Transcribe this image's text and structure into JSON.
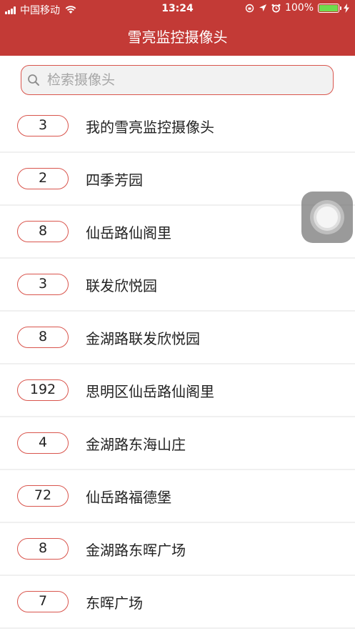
{
  "status_bar": {
    "carrier": "中国移动",
    "time": "13:24",
    "battery_percent": "100%",
    "icons": [
      "signal-icon",
      "wifi-icon",
      "rotation-lock-icon",
      "location-icon",
      "alarm-icon",
      "battery-icon",
      "charging-icon"
    ]
  },
  "header": {
    "title": "雪亮监控摄像头",
    "background": "#c33a36"
  },
  "search": {
    "placeholder": "检索摄像头",
    "value": ""
  },
  "accent": "#d9554d",
  "list": [
    {
      "count": "3",
      "name": "我的雪亮监控摄像头"
    },
    {
      "count": "2",
      "name": "四季芳园"
    },
    {
      "count": "8",
      "name": "仙岳路仙阁里"
    },
    {
      "count": "3",
      "name": "联发欣悦园"
    },
    {
      "count": "8",
      "name": "金湖路联发欣悦园"
    },
    {
      "count": "192",
      "name": "思明区仙岳路仙阁里"
    },
    {
      "count": "4",
      "name": "金湖路东海山庄"
    },
    {
      "count": "72",
      "name": "仙岳路福德堡"
    },
    {
      "count": "8",
      "name": "金湖路东晖广场"
    },
    {
      "count": "7",
      "name": "东晖广场"
    }
  ]
}
